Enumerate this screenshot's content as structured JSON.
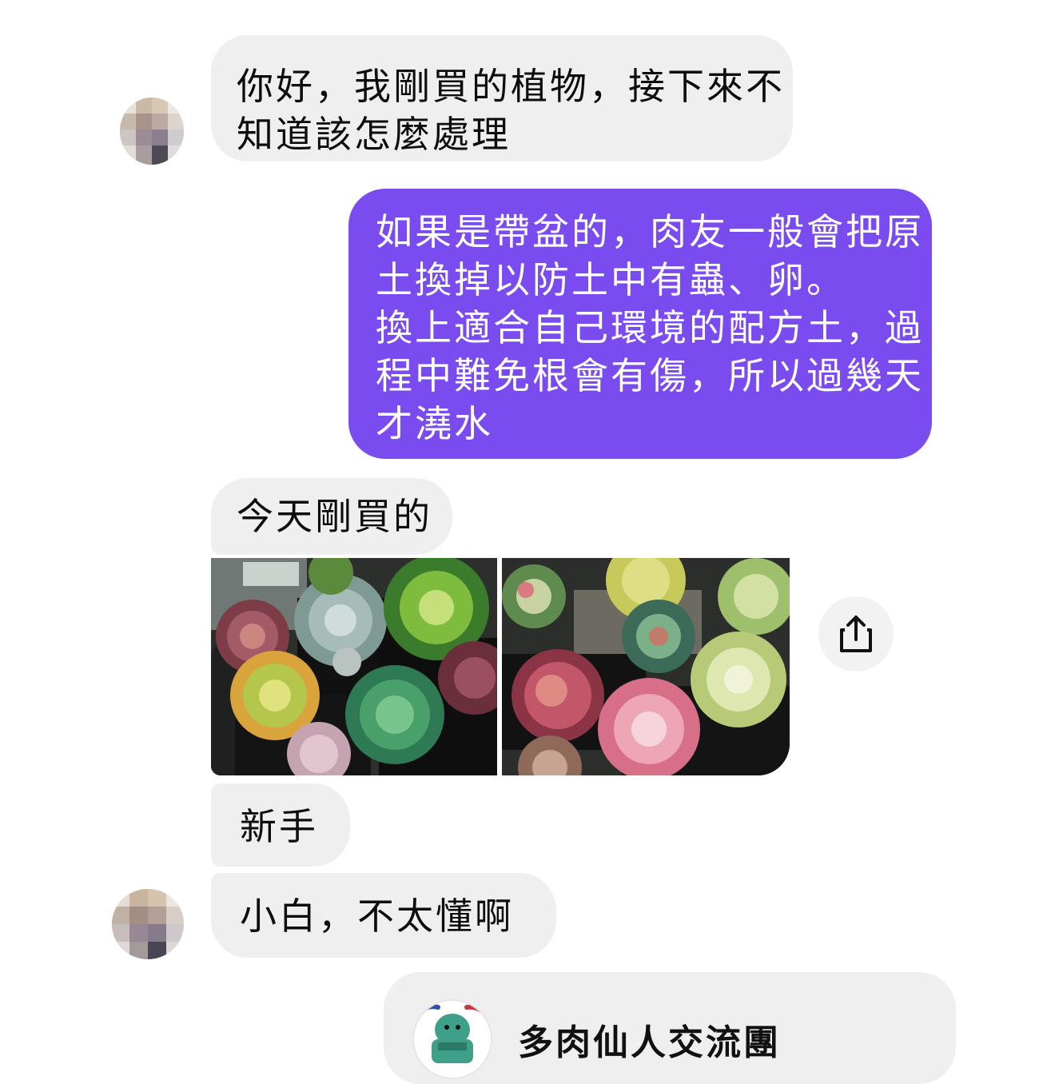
{
  "conversation": {
    "messages": [
      {
        "sender": "other",
        "lines": [
          "你好，我剛買的植物，接下來不",
          "知道該怎麼處理"
        ]
      },
      {
        "sender": "me",
        "lines": [
          "如果是帶盆的，肉友一般會把原",
          "土換掉以防土中有蟲、卵。",
          "換上適合自己環境的配方土，過",
          "程中難免根會有傷，所以過幾天",
          "才澆水"
        ]
      },
      {
        "sender": "other",
        "text": "今天剛買的"
      },
      {
        "sender": "other",
        "type": "photos",
        "photo_count": 2
      },
      {
        "sender": "other",
        "text": "新手"
      },
      {
        "sender": "other",
        "text": "小白，不太懂啊"
      },
      {
        "sender": "me",
        "type": "shared_card",
        "title": "多肉仙人交流團"
      }
    ]
  },
  "icons": {
    "share": "share-icon",
    "avatar": "avatar-blurred"
  },
  "colors": {
    "outgoing_bubble": "#7a4cf0",
    "incoming_bubble": "#efefef",
    "background": "#ffffff"
  }
}
